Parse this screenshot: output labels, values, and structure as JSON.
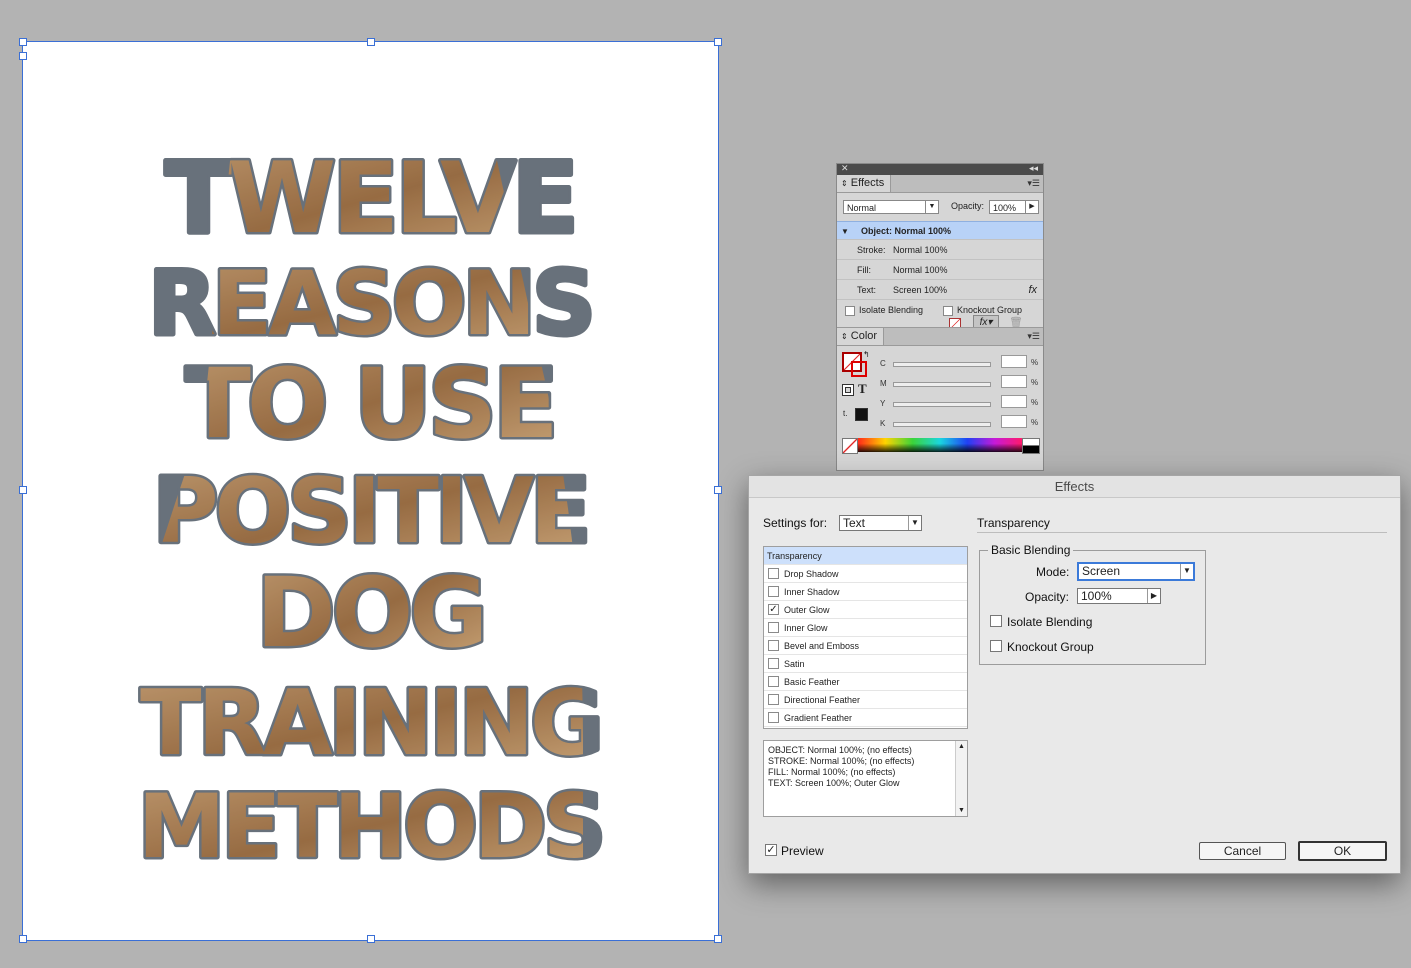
{
  "poster": {
    "lines": [
      "TWELVE",
      "REASONS",
      "TO USE",
      "POSITIVE",
      "DOG",
      "TRAINING",
      "METHODS"
    ]
  },
  "effects_panel": {
    "tab_label": "Effects",
    "blend_mode": "Normal",
    "opacity_label": "Opacity:",
    "opacity_value": "100%",
    "levels": {
      "object": "Object: Normal 100%",
      "stroke_label": "Stroke:",
      "stroke_value": "Normal 100%",
      "fill_label": "Fill:",
      "fill_value": "Normal 100%",
      "text_label": "Text:",
      "text_value": "Screen 100%",
      "fx_glyph": "fx"
    },
    "isolate_blending": "Isolate Blending",
    "knockout_group": "Knockout Group"
  },
  "color_panel": {
    "tab_label": "Color",
    "channels": [
      "C",
      "M",
      "Y",
      "K"
    ],
    "percent": "%",
    "t_glyph": "T"
  },
  "dialog": {
    "title": "Effects",
    "settings_for_label": "Settings for:",
    "settings_for_value": "Text",
    "section_title": "Transparency",
    "effects_list": [
      {
        "label": "Transparency",
        "checkbox": false,
        "checked": false,
        "selected": true
      },
      {
        "label": "Drop Shadow",
        "checkbox": true,
        "checked": false,
        "selected": false
      },
      {
        "label": "Inner Shadow",
        "checkbox": true,
        "checked": false,
        "selected": false
      },
      {
        "label": "Outer Glow",
        "checkbox": true,
        "checked": true,
        "selected": false
      },
      {
        "label": "Inner Glow",
        "checkbox": true,
        "checked": false,
        "selected": false
      },
      {
        "label": "Bevel and Emboss",
        "checkbox": true,
        "checked": false,
        "selected": false
      },
      {
        "label": "Satin",
        "checkbox": true,
        "checked": false,
        "selected": false
      },
      {
        "label": "Basic Feather",
        "checkbox": true,
        "checked": false,
        "selected": false
      },
      {
        "label": "Directional Feather",
        "checkbox": true,
        "checked": false,
        "selected": false
      },
      {
        "label": "Gradient Feather",
        "checkbox": true,
        "checked": false,
        "selected": false
      }
    ],
    "summary_lines": [
      "OBJECT: Normal 100%; (no effects)",
      "STROKE: Normal 100%; (no effects)",
      "FILL: Normal 100%; (no effects)",
      "TEXT: Screen 100%; Outer Glow"
    ],
    "basic_blending": {
      "legend": "Basic Blending",
      "mode_label": "Mode:",
      "mode_value": "Screen",
      "opacity_label": "Opacity:",
      "opacity_value": "100%",
      "isolate_blending": "Isolate Blending",
      "knockout_group": "Knockout Group"
    },
    "preview_label": "Preview",
    "preview_checked": true,
    "cancel_label": "Cancel",
    "ok_label": "OK"
  }
}
